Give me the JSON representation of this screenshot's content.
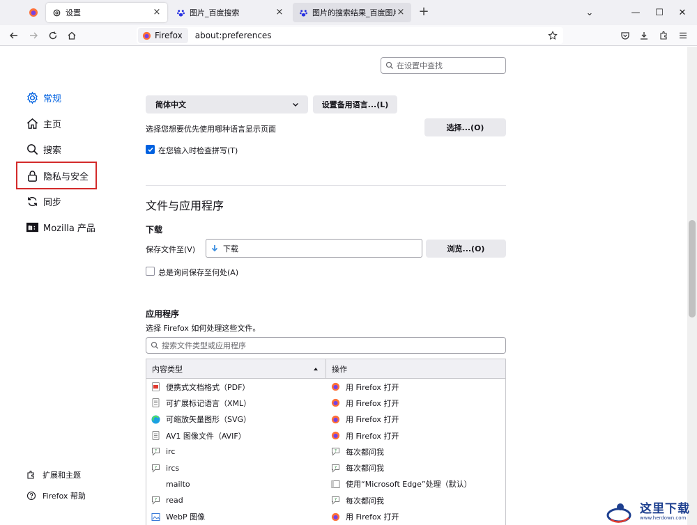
{
  "tabs": [
    {
      "title": "设置",
      "close": "×"
    },
    {
      "title": "图片_百度搜索",
      "close": "×"
    },
    {
      "title": "图片的搜索结果_百度图片搜索",
      "close": "×"
    }
  ],
  "new_tab": "+",
  "window_controls": {
    "list": "⌄",
    "minimize": "—",
    "maximize": "☐",
    "close": "✕"
  },
  "urlbar": {
    "badge": "Firefox",
    "url": "about:preferences"
  },
  "sidebar": {
    "items": [
      {
        "label": "常规",
        "icon": "gear-icon"
      },
      {
        "label": "主页",
        "icon": "home-icon"
      },
      {
        "label": "搜索",
        "icon": "search-icon"
      },
      {
        "label": "隐私与安全",
        "icon": "lock-icon"
      },
      {
        "label": "同步",
        "icon": "sync-icon"
      },
      {
        "label": "Mozilla 产品",
        "icon": "mozilla-icon"
      }
    ],
    "bottom": [
      {
        "label": "扩展和主题",
        "icon": "puzzle-icon"
      },
      {
        "label": "Firefox 帮助",
        "icon": "help-icon"
      }
    ]
  },
  "settings_search": {
    "placeholder": "在设置中查找"
  },
  "language": {
    "selected": "简体中文",
    "alt_button": "设置备用语言...(L)",
    "desc": "选择您想要优先使用哪种语言显示页面",
    "choose_button": "选择...(O)",
    "spellcheck": "在您输入时检查拼写(T)"
  },
  "files_section": {
    "title": "文件与应用程序",
    "downloads_title": "下载",
    "save_to_label": "保存文件至(V)",
    "save_to_value": "下载",
    "browse_button": "浏览...(O)",
    "always_ask": "总是询问保存至何处(A)"
  },
  "apps": {
    "title": "应用程序",
    "desc": "选择 Firefox 如何处理这些文件。",
    "search_placeholder": "搜索文件类型或应用程序",
    "col_type": "内容类型",
    "col_action": "操作",
    "rows": [
      {
        "type": "便携式文档格式（PDF）",
        "action": "用 Firefox 打开",
        "ticon": "pdf-icon",
        "aicon": "firefox-icon"
      },
      {
        "type": "可扩展标记语言（XML）",
        "action": "用 Firefox 打开",
        "ticon": "file-icon",
        "aicon": "firefox-icon"
      },
      {
        "type": "可缩放矢量图形（SVG）",
        "action": "用 Firefox 打开",
        "ticon": "edge-icon",
        "aicon": "firefox-icon"
      },
      {
        "type": "AV1 图像文件（AVIF）",
        "action": "用 Firefox 打开",
        "ticon": "file-icon",
        "aicon": "firefox-icon"
      },
      {
        "type": "irc",
        "action": "每次都问我",
        "ticon": "ask-icon",
        "aicon": "ask-icon"
      },
      {
        "type": "ircs",
        "action": "每次都问我",
        "ticon": "ask-icon",
        "aicon": "ask-icon"
      },
      {
        "type": "mailto",
        "action": "使用“Microsoft Edge”处理（默认）",
        "ticon": "",
        "aicon": "app-icon"
      },
      {
        "type": "read",
        "action": "每次都问我",
        "ticon": "ask-icon",
        "aicon": "ask-icon"
      },
      {
        "type": "WebP 图像",
        "action": "用 Firefox 打开",
        "ticon": "image-icon",
        "aicon": "firefox-icon"
      }
    ]
  },
  "watermark": {
    "text": "这里下载",
    "sub": "www.herdown.com"
  },
  "colors": {
    "accent": "#0061e0",
    "highlight": "#d32a2a",
    "firefox": "#ff7139"
  }
}
